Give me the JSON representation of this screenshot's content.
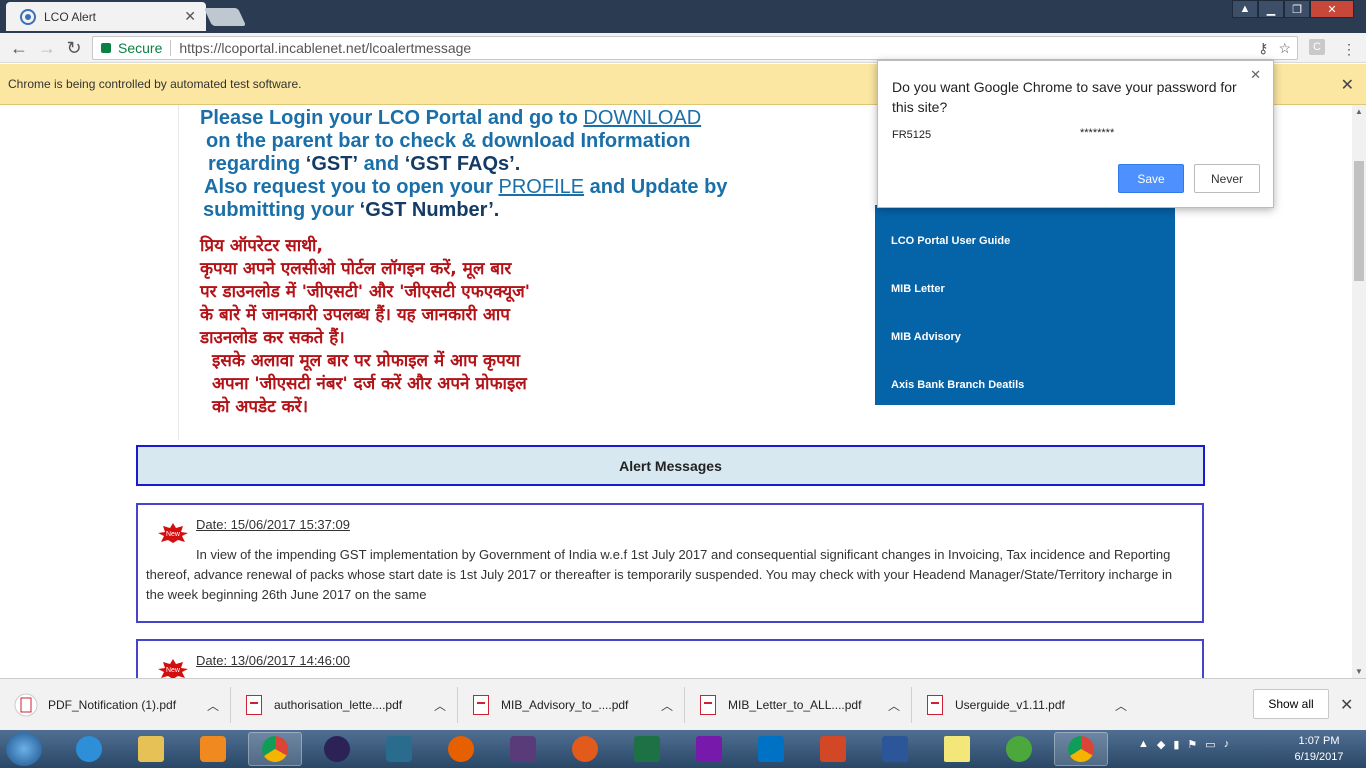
{
  "browser": {
    "tab_title": "LCO Alert",
    "secure_label": "Secure",
    "url": "https://lcoportal.incablenet.net/lcoalertmessage",
    "extension_letter": "C",
    "infobar_text": "Chrome is being controlled by automated test software."
  },
  "banner": {
    "en_line1_pre": "Please Login your LCO Portal and go to ",
    "en_download": "DOWNLOAD",
    "en_line2": "on the parent bar to check & download Information",
    "en_line3_pre": "regarding ",
    "en_gst": "‘GST’",
    "en_and": " and ",
    "en_gstfaqs": "‘GST FAQs’.",
    "en_line4_pre": "Also request you to open your ",
    "en_profile": "PROFILE",
    "en_line4_post": " and Update by",
    "en_line5_pre": "submitting your ",
    "en_gstnumber": "‘GST Number’.",
    "hi_line1": "प्रिय ऑपरेटर साथी,",
    "hi_line2": "कृपया अपने एलसीओ पोर्टल लॉगइन करें, मूल बार",
    "hi_line3": "पर डाउनलोड में 'जीएसटी' और 'जीएसटी एफएक्यूज'",
    "hi_line4": "के बारे में जानकारी उपलब्ध हैं। यह जानकारी आप",
    "hi_line5": "डाउनलोड कर सकते हैं।",
    "hi_line6": "इसके अलावा मूल बार पर प्रोफाइल में आप कृपया",
    "hi_line7": "अपना 'जीएसटी नंबर' दर्ज करें और अपने प्रोफाइल",
    "hi_line8": "को अपडेट करें।"
  },
  "sidebar_links": [
    "LCO Portal User Guide",
    "MIB Letter",
    "MIB Advisory",
    "Axis Bank Branch Deatils"
  ],
  "alerts": {
    "header": "Alert Messages",
    "messages": [
      {
        "badge": "New",
        "date": "Date: 15/06/2017 15:37:09",
        "text": "In view of the impending GST implementation by Government of India w.e.f 1st July 2017 and consequential significant changes in Invoicing, Tax incidence and Reporting thereof, advance renewal of packs whose start date is 1st July 2017 or thereafter is temporarily suspended. You may check with your Headend Manager/State/Territory incharge in the week beginning 26th June 2017 on the same"
      },
      {
        "badge": "New",
        "date": "Date: 13/06/2017 14:46:00",
        "text": ""
      }
    ]
  },
  "password_popup": {
    "title": "Do you want Google Chrome to save your password for this site?",
    "username": "FR5125",
    "password": "********",
    "save_label": "Save",
    "never_label": "Never"
  },
  "downloads": {
    "items": [
      "PDF_Notification (1).pdf",
      "authorisation_lette....pdf",
      "MIB_Advisory_to_....pdf",
      "MIB_Letter_to_ALL....pdf",
      "Userguide_v1.11.pdf"
    ],
    "show_all": "Show all"
  },
  "taskbar": {
    "time": "1:07 PM",
    "date": "6/19/2017"
  }
}
